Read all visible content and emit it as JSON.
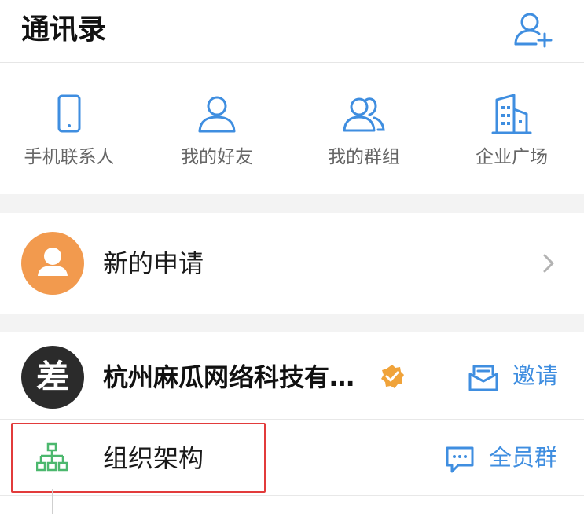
{
  "header": {
    "title": "通讯录",
    "add_icon": "add-contact-icon"
  },
  "quick_entries": [
    {
      "label": "手机联系人",
      "icon": "phone-icon"
    },
    {
      "label": "我的好友",
      "icon": "person-icon"
    },
    {
      "label": "我的群组",
      "icon": "group-icon"
    },
    {
      "label": "企业广场",
      "icon": "building-icon"
    }
  ],
  "new_request": {
    "label": "新的申请",
    "avatar_icon": "user-silhouette-icon"
  },
  "organization": {
    "logo_text": "差",
    "name": "杭州麻瓜网络科技有…",
    "verified_icon": "verified-badge-icon",
    "invite_label": "邀请",
    "structure_label": "组织架构",
    "all_members_group_label": "全员群"
  },
  "colors": {
    "accent_blue": "#3f8ee0",
    "avatar_orange": "#f29a4e",
    "verified_orange": "#f0a33a",
    "org_structure_green": "#4cb86e",
    "highlight_red": "#e23b3b"
  }
}
